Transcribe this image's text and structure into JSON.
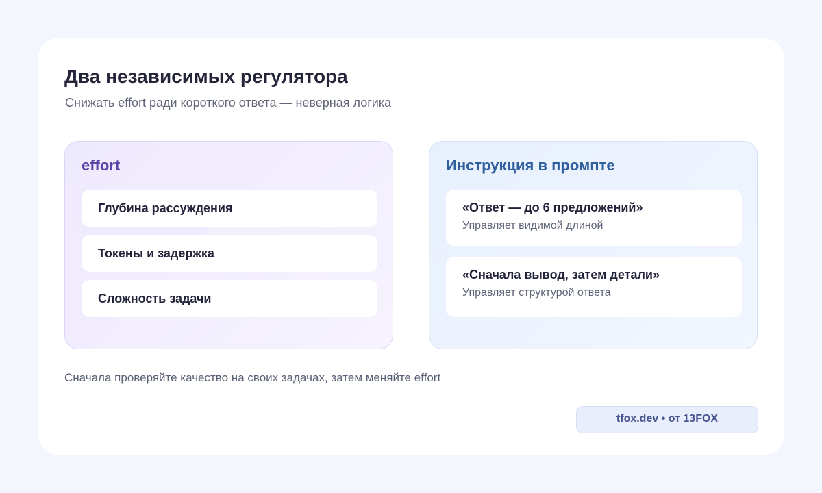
{
  "title": "Два независимых регулятора",
  "subtitle": "Снижать effort ради короткого ответа — неверная логика",
  "left_panel": {
    "heading": "effort",
    "items": [
      {
        "label": "Глубина рассуждения"
      },
      {
        "label": "Токены и задержка"
      },
      {
        "label": "Сложность задачи"
      }
    ]
  },
  "right_panel": {
    "heading": "Инструкция в промпте",
    "items": [
      {
        "label": "«Ответ — до 6 предложений»",
        "desc": "Управляет видимой длиной"
      },
      {
        "label": "«Сначала вывод, затем детали»",
        "desc": "Управляет структурой ответа"
      }
    ]
  },
  "note": "Сначала проверяйте качество на своих задачах, затем меняйте effort",
  "credit": "tfox.dev • от 13FOX"
}
